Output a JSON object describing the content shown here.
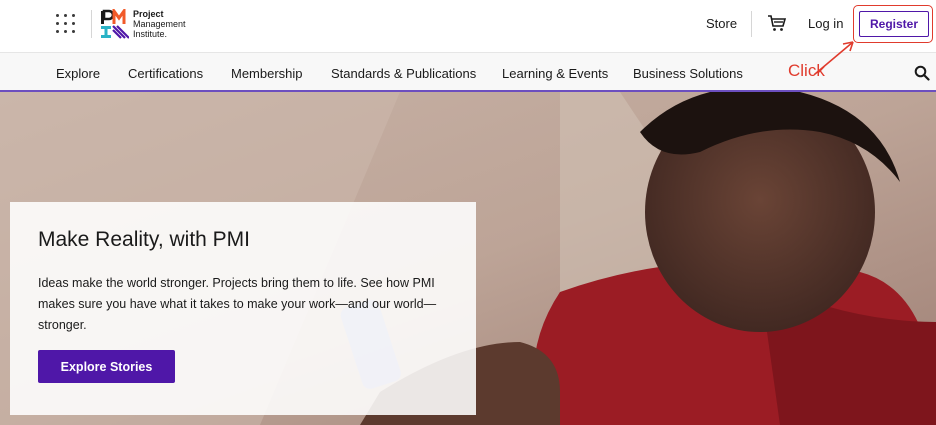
{
  "header": {
    "logo": {
      "line1": "Project",
      "line2": "Management",
      "line3": "Institute."
    },
    "store_label": "Store",
    "login_label": "Log in",
    "register_label": "Register"
  },
  "nav": {
    "items": [
      {
        "label": "Explore"
      },
      {
        "label": "Certifications"
      },
      {
        "label": "Membership"
      },
      {
        "label": "Standards & Publications"
      },
      {
        "label": "Learning & Events"
      },
      {
        "label": "Business Solutions"
      }
    ]
  },
  "annotation": {
    "text": "Click",
    "color": "#e03b2d"
  },
  "hero": {
    "title": "Make Reality, with PMI",
    "body": "Ideas make the world stronger. Projects bring them to life. See how PMI makes sure you have what it takes to make your work—and our world—stronger.",
    "cta_label": "Explore Stories"
  },
  "colors": {
    "brand_purple": "#4f17a8",
    "annotation_red": "#e03b2d",
    "logo_orange": "#f15a29",
    "logo_teal": "#2ab3c6"
  },
  "icons": [
    "apps-grid-icon",
    "pmi-logo",
    "cart-icon",
    "search-icon"
  ]
}
